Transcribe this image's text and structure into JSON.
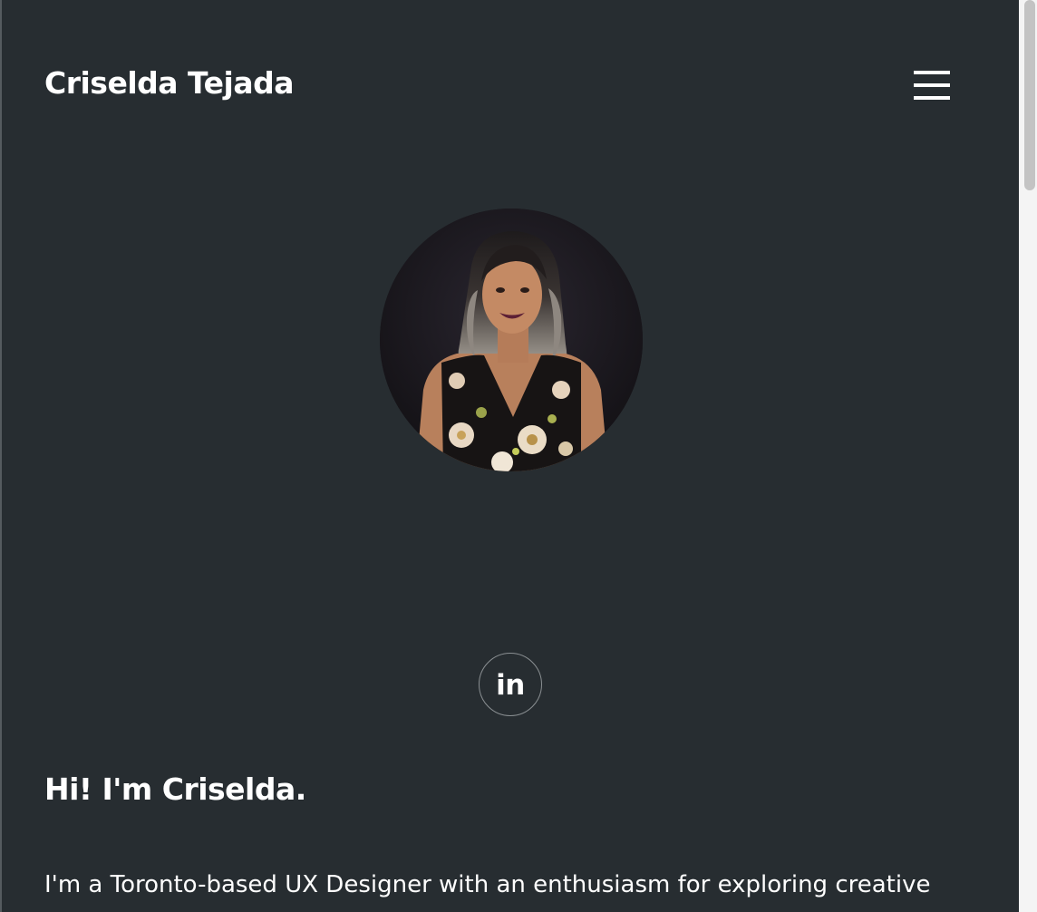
{
  "header": {
    "site_title": "Criselda Tejada",
    "menu_icon": "hamburger-menu-icon"
  },
  "hero": {
    "avatar_icon": "profile-photo"
  },
  "social": {
    "linkedin_label": "in"
  },
  "about": {
    "heading": "Hi! I'm Criselda.",
    "intro": "I'm a Toronto-based UX Designer with an enthusiasm for exploring creative"
  },
  "colors": {
    "background": "#272d31",
    "text": "#ffffff",
    "circle_border": "#8a8f92"
  }
}
